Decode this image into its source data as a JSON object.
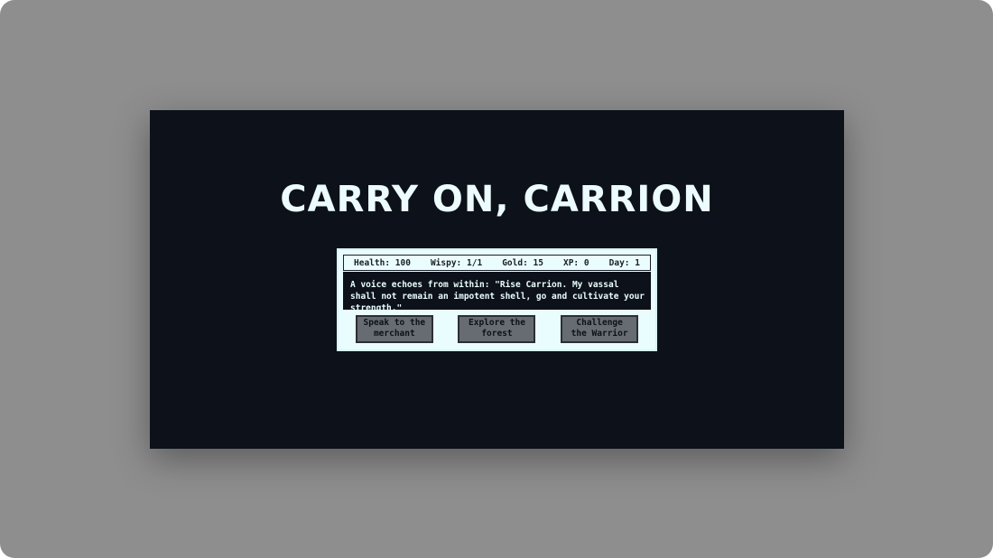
{
  "game": {
    "title": "CARRY ON, CARRION",
    "stats": {
      "health_label": "Health:",
      "health_value": "100",
      "wispy_label": "Wispy:",
      "wispy_value": "1/1",
      "gold_label": "Gold:",
      "gold_value": "15",
      "xp_label": "XP:",
      "xp_value": "0",
      "day_label": "Day:",
      "day_value": "1"
    },
    "message": "A voice echoes from within: \"Rise Carrion. My vassal shall not remain an impotent shell, go and cultivate your strength.\"",
    "actions": [
      {
        "label": "Speak to the merchant"
      },
      {
        "label": "Explore the forest"
      },
      {
        "label": "Challenge the Warrior"
      }
    ]
  },
  "colors": {
    "page_bg": "#8e8e8e",
    "screen_bg": "#0c111a",
    "panel_bg": "#eafdfe",
    "button_bg": "#676c73",
    "title_color": "#ecfbfd"
  }
}
